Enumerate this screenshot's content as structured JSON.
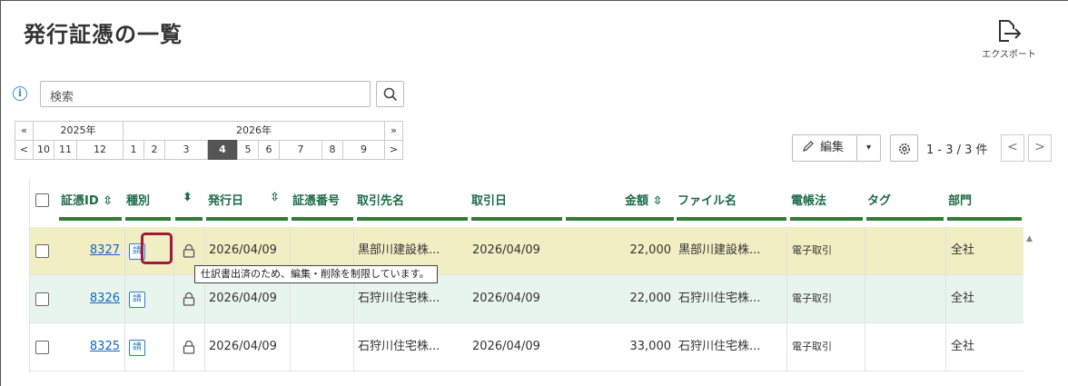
{
  "page": {
    "title": "発行証憑の一覧"
  },
  "export": {
    "label": "エクスポート",
    "icon": "export-icon"
  },
  "search": {
    "placeholder": "検索",
    "info_icon": "info-icon",
    "button_icon": "search-icon"
  },
  "calendar": {
    "prev_year": "«",
    "next_year": "»",
    "prev_month": "<",
    "next_month": ">",
    "years": [
      "2025年",
      "2026年"
    ],
    "months": [
      "10",
      "11",
      "12",
      "1",
      "2",
      "3",
      "4",
      "5",
      "6",
      "7",
      "8",
      "9"
    ],
    "selected_month": "4"
  },
  "toolbar": {
    "edit_label": "編集",
    "edit_icon": "pencil-icon",
    "dropdown": "▾",
    "settings_icon": "gear-icon",
    "page_info": "1 - 3 / 3 件",
    "prev": "<",
    "next": ">"
  },
  "table": {
    "headers": {
      "id": "証憑ID",
      "type": "種別",
      "issue_date": "発行日",
      "doc_no": "証憑番号",
      "partner": "取引先名",
      "trade_date": "取引日",
      "amount": "金額",
      "filename": "ファイル名",
      "ebook": "電帳法",
      "tag": "タグ",
      "dept": "部門"
    },
    "rows": [
      {
        "id": "8327",
        "type": "請",
        "issue_date": "2026/04/09",
        "doc_no": "",
        "partner": "黒部川建設株...",
        "trade_date": "2026/04/09",
        "amount": "22,000",
        "filename": "黒部川建設株...",
        "ebook": "電子取引",
        "tag": "",
        "dept": "全社",
        "bg": "#f1eec3"
      },
      {
        "id": "8326",
        "type": "請",
        "issue_date": "2026/04/09",
        "doc_no": "",
        "partner": "石狩川住宅株...",
        "trade_date": "2026/04/09",
        "amount": "22,000",
        "filename": "石狩川住宅株...",
        "ebook": "電子取引",
        "tag": "",
        "dept": "全社",
        "bg": "#e8f5ec"
      },
      {
        "id": "8325",
        "type": "請",
        "issue_date": "2026/04/09",
        "doc_no": "",
        "partner": "石狩川住宅株...",
        "trade_date": "2026/04/09",
        "amount": "33,000",
        "filename": "石狩川住宅株...",
        "ebook": "電子取引",
        "tag": "",
        "dept": "全社",
        "bg": "#ffffff"
      }
    ]
  },
  "tooltip": {
    "text": "仕訳書出済のため、編集・削除を制限しています。"
  },
  "colors": {
    "accent_green": "#2e7d32",
    "link_blue": "#1565c0",
    "highlight": "#9c1b3a"
  }
}
